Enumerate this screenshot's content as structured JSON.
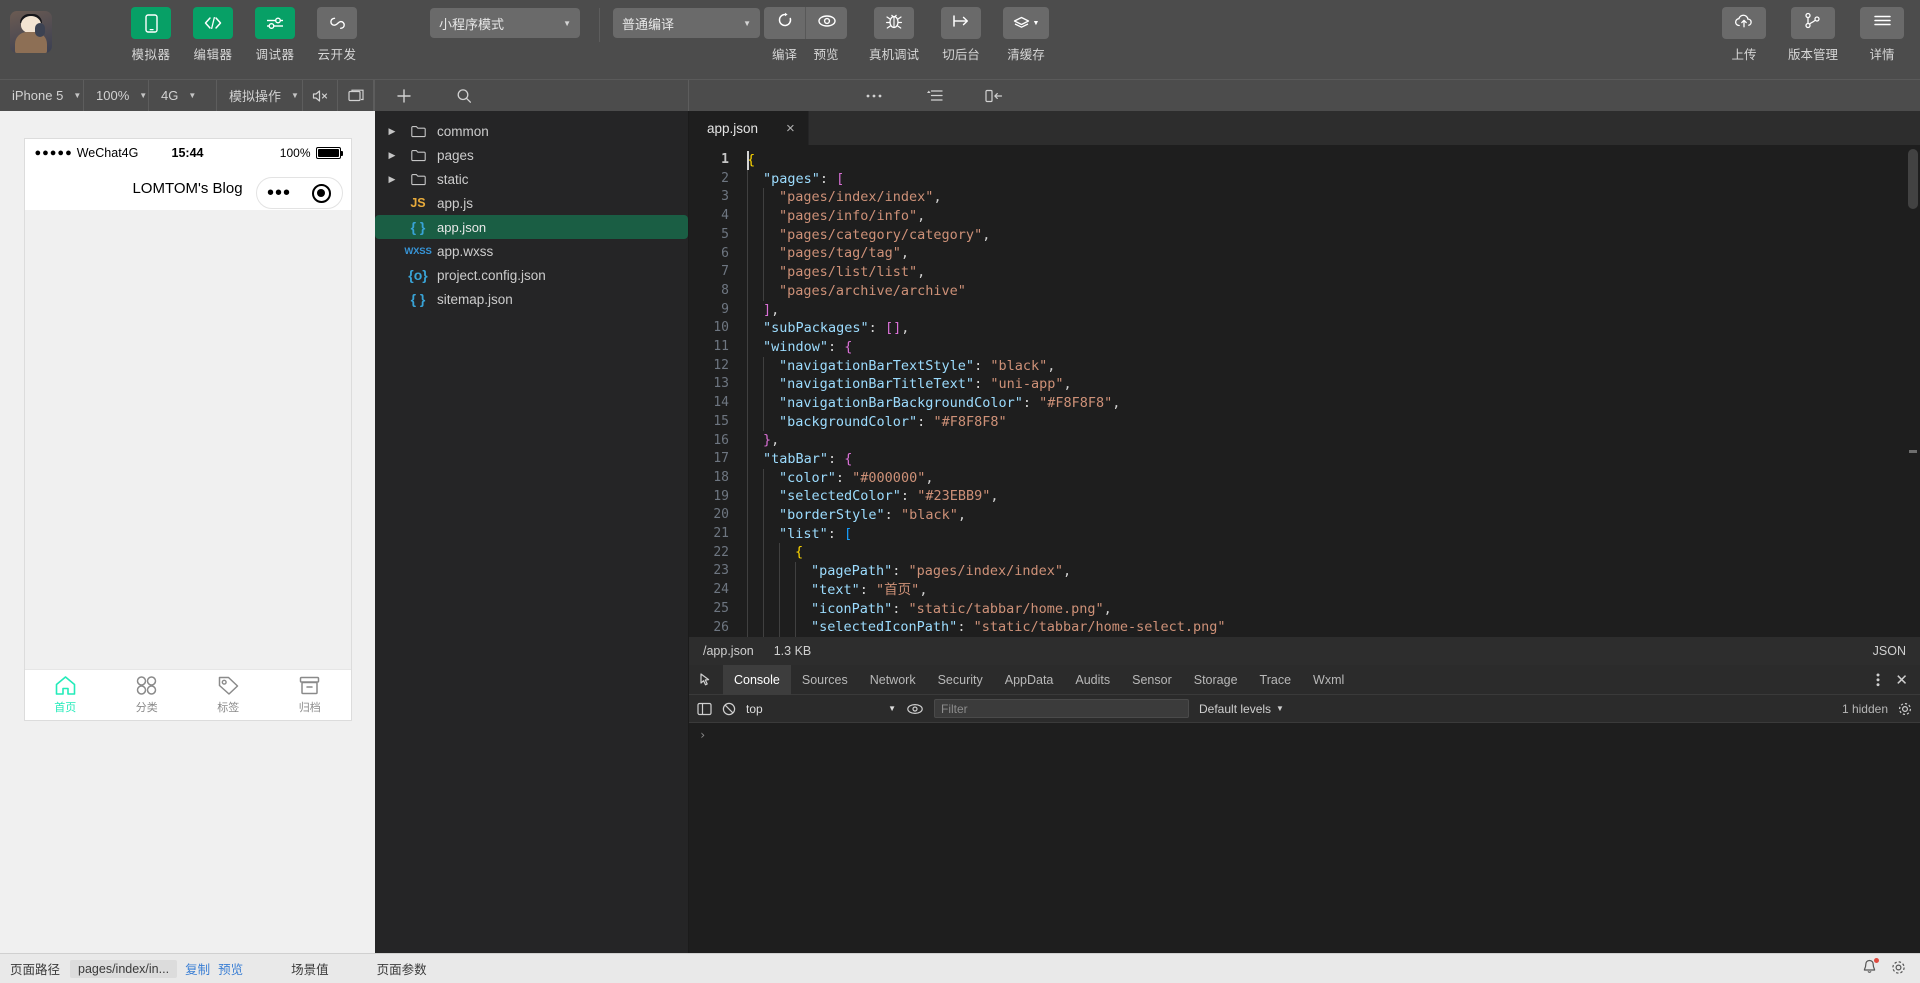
{
  "toolbar": {
    "avatar_name": "user-avatar",
    "buttons": [
      {
        "label": "模拟器",
        "icon": "phone-icon",
        "style": "green"
      },
      {
        "label": "编辑器",
        "icon": "code-icon",
        "style": "green"
      },
      {
        "label": "调试器",
        "icon": "sliders-icon",
        "style": "green"
      },
      {
        "label": "云开发",
        "icon": "cloud-dev-icon",
        "style": "grey"
      }
    ],
    "mode_select": {
      "value": "小程序模式"
    },
    "compile_select": {
      "value": "普通编译"
    },
    "actions": [
      {
        "label": "编译",
        "icon": "refresh-icon"
      },
      {
        "label": "预览",
        "icon": "eye-icon"
      },
      {
        "label": "真机调试",
        "icon": "bug-icon"
      },
      {
        "label": "切后台",
        "icon": "background-icon"
      },
      {
        "label": "清缓存",
        "icon": "layers-icon"
      }
    ],
    "right_actions": [
      {
        "label": "上传",
        "icon": "upload-cloud-icon"
      },
      {
        "label": "版本管理",
        "icon": "git-branch-icon"
      },
      {
        "label": "详情",
        "icon": "hamburger-icon"
      }
    ]
  },
  "subbar": {
    "device": "iPhone 5",
    "zoom": "100%",
    "network": "4G",
    "simulate": "模拟操作",
    "mute_icon": "mute-icon",
    "window_icon": "window-icon",
    "add_icon": "plus-icon",
    "search_icon": "search-icon",
    "more_icon": "more-icon",
    "outline_icon": "outline-icon",
    "split_icon": "split-editor-icon"
  },
  "simulator": {
    "status": {
      "signal": "●●●●●",
      "carrier": "WeChat4G",
      "time": "15:44",
      "battery_text": "100%"
    },
    "nav_title": "LOMTOM's Blog",
    "capsule": {
      "more": "•••",
      "target": "target-icon"
    },
    "tabbar": [
      {
        "label": "首页",
        "icon": "home-icon",
        "active": true
      },
      {
        "label": "分类",
        "icon": "category-icon",
        "active": false
      },
      {
        "label": "标签",
        "icon": "tag-icon",
        "active": false
      },
      {
        "label": "归档",
        "icon": "archive-icon",
        "active": false
      }
    ]
  },
  "filetree": [
    {
      "name": "common",
      "type": "folder",
      "expanded": false,
      "selected": false
    },
    {
      "name": "pages",
      "type": "folder",
      "expanded": false,
      "selected": false
    },
    {
      "name": "static",
      "type": "folder",
      "expanded": false,
      "selected": false
    },
    {
      "name": "app.js",
      "type": "js",
      "icon_text": "JS",
      "selected": false
    },
    {
      "name": "app.json",
      "type": "json",
      "icon_text": "{ }",
      "selected": true
    },
    {
      "name": "app.wxss",
      "type": "wxss",
      "icon_text": "WXSS",
      "selected": false
    },
    {
      "name": "project.config.json",
      "type": "json",
      "icon_text": "{o}",
      "selected": false
    },
    {
      "name": "sitemap.json",
      "type": "json",
      "icon_text": "{ }",
      "selected": false
    }
  ],
  "editor": {
    "tab": {
      "title": "app.json",
      "close": "×"
    },
    "status": {
      "path": "/app.json",
      "size": "1.3 KB",
      "language": "JSON"
    },
    "first_line": 1,
    "total_visible_lines": 26,
    "lines": [
      {
        "n": 1,
        "indent": 0,
        "tokens": [
          {
            "t": "{",
            "c": "br1"
          }
        ]
      },
      {
        "n": 2,
        "indent": 1,
        "tokens": [
          {
            "t": "\"pages\"",
            "c": "k"
          },
          {
            "t": ": ",
            "c": "p"
          },
          {
            "t": "[",
            "c": "br2"
          }
        ]
      },
      {
        "n": 3,
        "indent": 2,
        "tokens": [
          {
            "t": "\"pages/index/index\"",
            "c": "s"
          },
          {
            "t": ",",
            "c": "p"
          }
        ]
      },
      {
        "n": 4,
        "indent": 2,
        "tokens": [
          {
            "t": "\"pages/info/info\"",
            "c": "s"
          },
          {
            "t": ",",
            "c": "p"
          }
        ]
      },
      {
        "n": 5,
        "indent": 2,
        "tokens": [
          {
            "t": "\"pages/category/category\"",
            "c": "s"
          },
          {
            "t": ",",
            "c": "p"
          }
        ]
      },
      {
        "n": 6,
        "indent": 2,
        "tokens": [
          {
            "t": "\"pages/tag/tag\"",
            "c": "s"
          },
          {
            "t": ",",
            "c": "p"
          }
        ]
      },
      {
        "n": 7,
        "indent": 2,
        "tokens": [
          {
            "t": "\"pages/list/list\"",
            "c": "s"
          },
          {
            "t": ",",
            "c": "p"
          }
        ]
      },
      {
        "n": 8,
        "indent": 2,
        "tokens": [
          {
            "t": "\"pages/archive/archive\"",
            "c": "s"
          }
        ]
      },
      {
        "n": 9,
        "indent": 1,
        "tokens": [
          {
            "t": "]",
            "c": "br2"
          },
          {
            "t": ",",
            "c": "p"
          }
        ]
      },
      {
        "n": 10,
        "indent": 1,
        "tokens": [
          {
            "t": "\"subPackages\"",
            "c": "k"
          },
          {
            "t": ": ",
            "c": "p"
          },
          {
            "t": "[]",
            "c": "br2"
          },
          {
            "t": ",",
            "c": "p"
          }
        ]
      },
      {
        "n": 11,
        "indent": 1,
        "tokens": [
          {
            "t": "\"window\"",
            "c": "k"
          },
          {
            "t": ": ",
            "c": "p"
          },
          {
            "t": "{",
            "c": "br2"
          }
        ]
      },
      {
        "n": 12,
        "indent": 2,
        "tokens": [
          {
            "t": "\"navigationBarTextStyle\"",
            "c": "k"
          },
          {
            "t": ": ",
            "c": "p"
          },
          {
            "t": "\"black\"",
            "c": "s"
          },
          {
            "t": ",",
            "c": "p"
          }
        ]
      },
      {
        "n": 13,
        "indent": 2,
        "tokens": [
          {
            "t": "\"navigationBarTitleText\"",
            "c": "k"
          },
          {
            "t": ": ",
            "c": "p"
          },
          {
            "t": "\"uni-app\"",
            "c": "s"
          },
          {
            "t": ",",
            "c": "p"
          }
        ]
      },
      {
        "n": 14,
        "indent": 2,
        "tokens": [
          {
            "t": "\"navigationBarBackgroundColor\"",
            "c": "k"
          },
          {
            "t": ": ",
            "c": "p"
          },
          {
            "t": "\"#F8F8F8\"",
            "c": "s"
          },
          {
            "t": ",",
            "c": "p"
          }
        ]
      },
      {
        "n": 15,
        "indent": 2,
        "tokens": [
          {
            "t": "\"backgroundColor\"",
            "c": "k"
          },
          {
            "t": ": ",
            "c": "p"
          },
          {
            "t": "\"#F8F8F8\"",
            "c": "s"
          }
        ]
      },
      {
        "n": 16,
        "indent": 1,
        "tokens": [
          {
            "t": "}",
            "c": "br2"
          },
          {
            "t": ",",
            "c": "p"
          }
        ]
      },
      {
        "n": 17,
        "indent": 1,
        "tokens": [
          {
            "t": "\"tabBar\"",
            "c": "k"
          },
          {
            "t": ": ",
            "c": "p"
          },
          {
            "t": "{",
            "c": "br2"
          }
        ]
      },
      {
        "n": 18,
        "indent": 2,
        "tokens": [
          {
            "t": "\"color\"",
            "c": "k"
          },
          {
            "t": ": ",
            "c": "p"
          },
          {
            "t": "\"#000000\"",
            "c": "s"
          },
          {
            "t": ",",
            "c": "p"
          }
        ]
      },
      {
        "n": 19,
        "indent": 2,
        "tokens": [
          {
            "t": "\"selectedColor\"",
            "c": "k"
          },
          {
            "t": ": ",
            "c": "p"
          },
          {
            "t": "\"#23EBB9\"",
            "c": "s"
          },
          {
            "t": ",",
            "c": "p"
          }
        ]
      },
      {
        "n": 20,
        "indent": 2,
        "tokens": [
          {
            "t": "\"borderStyle\"",
            "c": "k"
          },
          {
            "t": ": ",
            "c": "p"
          },
          {
            "t": "\"black\"",
            "c": "s"
          },
          {
            "t": ",",
            "c": "p"
          }
        ]
      },
      {
        "n": 21,
        "indent": 2,
        "tokens": [
          {
            "t": "\"list\"",
            "c": "k"
          },
          {
            "t": ": ",
            "c": "p"
          },
          {
            "t": "[",
            "c": "br3"
          }
        ]
      },
      {
        "n": 22,
        "indent": 3,
        "tokens": [
          {
            "t": "{",
            "c": "br1"
          }
        ]
      },
      {
        "n": 23,
        "indent": 4,
        "tokens": [
          {
            "t": "\"pagePath\"",
            "c": "k"
          },
          {
            "t": ": ",
            "c": "p"
          },
          {
            "t": "\"pages/index/index\"",
            "c": "s"
          },
          {
            "t": ",",
            "c": "p"
          }
        ]
      },
      {
        "n": 24,
        "indent": 4,
        "tokens": [
          {
            "t": "\"text\"",
            "c": "k"
          },
          {
            "t": ": ",
            "c": "p"
          },
          {
            "t": "\"首页\"",
            "c": "s"
          },
          {
            "t": ",",
            "c": "p"
          }
        ]
      },
      {
        "n": 25,
        "indent": 4,
        "tokens": [
          {
            "t": "\"iconPath\"",
            "c": "k"
          },
          {
            "t": ": ",
            "c": "p"
          },
          {
            "t": "\"static/tabbar/home.png\"",
            "c": "s"
          },
          {
            "t": ",",
            "c": "p"
          }
        ]
      },
      {
        "n": 26,
        "indent": 4,
        "tokens": [
          {
            "t": "\"selectedIconPath\"",
            "c": "k"
          },
          {
            "t": ": ",
            "c": "p"
          },
          {
            "t": "\"static/tabbar/home-select.png\"",
            "c": "s"
          }
        ]
      }
    ]
  },
  "devtools": {
    "tabs": [
      {
        "label": "Console",
        "active": true
      },
      {
        "label": "Sources",
        "active": false
      },
      {
        "label": "Network",
        "active": false
      },
      {
        "label": "Security",
        "active": false
      },
      {
        "label": "AppData",
        "active": false
      },
      {
        "label": "Audits",
        "active": false
      },
      {
        "label": "Sensor",
        "active": false
      },
      {
        "label": "Storage",
        "active": false
      },
      {
        "label": "Trace",
        "active": false
      },
      {
        "label": "Wxml",
        "active": false
      }
    ],
    "toolbar2": {
      "context": "top",
      "filter_placeholder": "Filter",
      "levels": "Default levels",
      "hidden": "1 hidden",
      "prompt": "›"
    }
  },
  "statusbar": {
    "page_path_label": "页面路径",
    "page_path_value": "pages/index/in...",
    "copy": "复制",
    "preview": "预览",
    "scene": "场景值",
    "page_params": "页面参数",
    "bell_icon": "bell-icon",
    "settings_icon": "gear-icon"
  }
}
